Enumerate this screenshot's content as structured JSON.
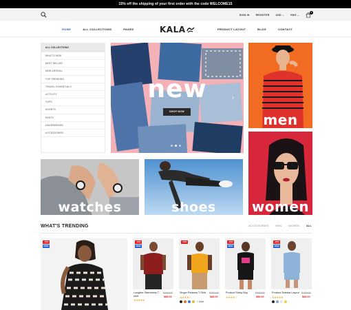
{
  "promo": {
    "text": "15% off the shipping of your first order with the code WELCOME15"
  },
  "utility": {
    "signin": "SIGN IN",
    "register": "REGISTER",
    "currency": "USD ⌄",
    "language": "ENG ⌄",
    "cart_count": "0"
  },
  "nav": {
    "left": [
      {
        "label": "HOME",
        "active": true
      },
      {
        "label": "ALL COLLECTIONS",
        "active": false
      },
      {
        "label": "PAGES",
        "active": false
      }
    ],
    "logo": "KALA",
    "right": [
      {
        "label": "PRODUCT LAYOUT"
      },
      {
        "label": "BLOG"
      },
      {
        "label": "CONTACT"
      }
    ]
  },
  "sidebar": {
    "items": [
      "ALL COLLECTIONS",
      "WHAT'S NEW",
      "BEST SELLER",
      "NEW ARRIVAL",
      "TOP TRENDING",
      "TRAVEL ESSENTIALS",
      "ACTIVITY",
      "TOPS",
      "SHORTS",
      "PANTS",
      "UNDERWEARS",
      "ACCESSORIES"
    ]
  },
  "hero": {
    "title": "new",
    "button": "SHOP NOW"
  },
  "tiles": {
    "men": "men",
    "watches": "watches",
    "shoes": "shoes",
    "women": "women"
  },
  "trending": {
    "title": "WHAT'S TRENDING",
    "tabs": [
      "ACCESSORIES",
      "MEN",
      "WOMEN",
      "ALL"
    ],
    "active_tab": "ALL"
  },
  "products": [
    {
      "badges": [
        "-15%",
        "NEW"
      ],
      "name": "",
      "old": "",
      "price": ""
    },
    {
      "badges": [
        "-15%",
        "NEW"
      ],
      "name": "Longline Sleeveless T-shirt",
      "old": "$100.00",
      "price": "$88.00",
      "stars": "★★★★★",
      "swatches": []
    },
    {
      "badges": [
        "-15%"
      ],
      "name": "Singer Relaxed T-Shirt",
      "old": "$100.00",
      "price": "$88.00",
      "stars": "★★★★☆",
      "swatches": [
        "#222222",
        "#e46f2c",
        "#2f7fd8",
        "#e5bd3a"
      ],
      "more": "+ More"
    },
    {
      "badges": [
        "-15%",
        "NEW"
      ],
      "name": "Product Sticky Buy",
      "old": "$100.00",
      "price": "$88.00",
      "stars": "★★★★☆",
      "swatches": []
    },
    {
      "badges": [
        "-15%",
        "NEW"
      ],
      "name": "Product Sidebar Layout",
      "old": "$100.00",
      "price": "$88.00",
      "stars": "★★★★★",
      "swatches": [
        "#222222",
        "#8aa8c8",
        "#e5e5e5",
        "#f0d040"
      ]
    }
  ],
  "colors": {
    "accent": "#2a5fb5",
    "sale": "#e02020",
    "new": "#2a5fd8",
    "men_bg": "#f26b22",
    "women_bg": "#d8273a",
    "hero_bg": "#f4b1b8"
  }
}
